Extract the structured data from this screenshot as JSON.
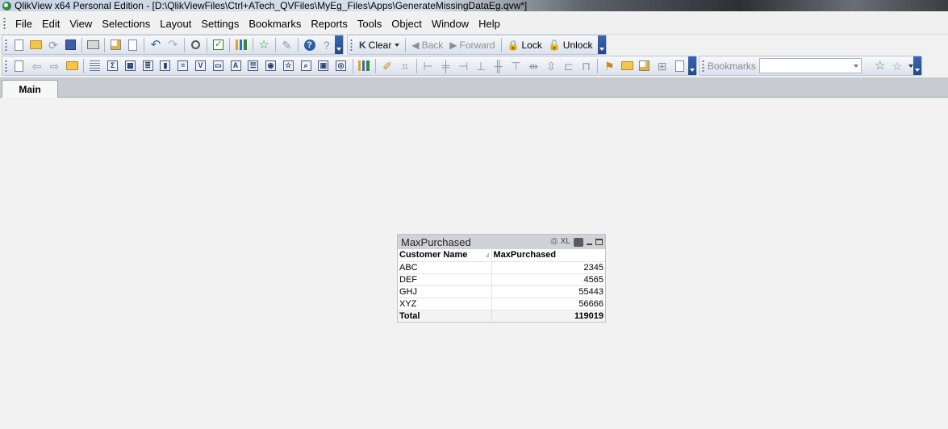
{
  "window": {
    "title": "QlikView x64 Personal Edition - [D:\\QlikViewFiles\\Ctrl+ATech_QVFiles\\MyEg_Files\\Apps\\GenerateMissingDataEg.qvw*]"
  },
  "menubar": {
    "items": [
      "File",
      "Edit",
      "View",
      "Selections",
      "Layout",
      "Settings",
      "Bookmarks",
      "Reports",
      "Tools",
      "Object",
      "Window",
      "Help"
    ]
  },
  "navbar": {
    "clear": "Clear",
    "back": "Back",
    "forward": "Forward",
    "lock": "Lock",
    "unlock": "Unlock"
  },
  "bookmarks": {
    "label": "Bookmarks",
    "value": ""
  },
  "tabs": [
    "Main"
  ],
  "table_box": {
    "caption": "MaxPurchased",
    "caption_icons": {
      "xl": "XL"
    },
    "columns": [
      "Customer Name",
      "MaxPurchased"
    ],
    "rows": [
      {
        "name": "ABC",
        "value": "2345"
      },
      {
        "name": "DEF",
        "value": "4565"
      },
      {
        "name": "GHJ",
        "value": "55443"
      },
      {
        "name": "XYZ",
        "value": "56666"
      }
    ],
    "total": {
      "label": "Total",
      "value": "119019"
    }
  }
}
